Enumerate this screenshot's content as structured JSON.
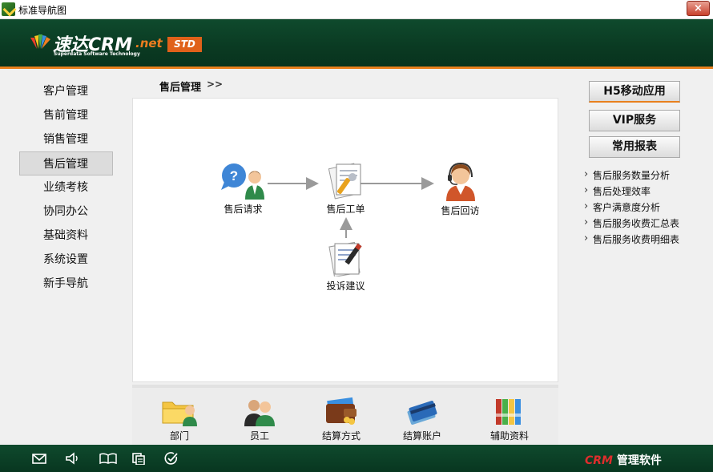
{
  "window": {
    "title": "标准导航图",
    "close_label": "×"
  },
  "header": {
    "logo_main": "速达CRM",
    "logo_net": ".net",
    "logo_sub": "Superdata Software Technology",
    "edition": "STD"
  },
  "left_menu": [
    {
      "label": "客户管理",
      "active": false
    },
    {
      "label": "售前管理",
      "active": false
    },
    {
      "label": "销售管理",
      "active": false
    },
    {
      "label": "售后管理",
      "active": true
    },
    {
      "label": "业绩考核",
      "active": false
    },
    {
      "label": "协同办公",
      "active": false
    },
    {
      "label": "基础资料",
      "active": false
    },
    {
      "label": "系统设置",
      "active": false
    },
    {
      "label": "新手导航",
      "active": false
    }
  ],
  "breadcrumb": {
    "current": "售后管理",
    "arrow": ">>"
  },
  "flow": {
    "request": {
      "label": "售后请求",
      "icon": "question-person-icon"
    },
    "work_order": {
      "label": "售后工单",
      "icon": "document-wrench-icon"
    },
    "revisit": {
      "label": "售后回访",
      "icon": "headset-agent-icon"
    },
    "complaint": {
      "label": "投诉建议",
      "icon": "document-pen-icon"
    }
  },
  "tools": [
    {
      "label": "部门",
      "icon": "folder-person-icon"
    },
    {
      "label": "员工",
      "icon": "people-icon"
    },
    {
      "label": "结算方式",
      "icon": "wallet-icon"
    },
    {
      "label": "结算账户",
      "icon": "bank-card-icon"
    },
    {
      "label": "辅助资料",
      "icon": "binders-icon"
    }
  ],
  "right_panel": {
    "h5_button": "H5移动应用",
    "vip_button": "VIP服务",
    "report_button": "常用报表",
    "reports": [
      "售后服务数量分析",
      "售后处理效率",
      "客户满意度分析",
      "售后服务收费汇总表",
      "售后服务收费明细表"
    ]
  },
  "status_bar": {
    "icons": [
      "mail-icon",
      "speaker-icon",
      "book-icon",
      "copy-icon",
      "check-circle-icon"
    ],
    "brand_crm": "CRM",
    "brand_text": " 管理软件"
  },
  "colors": {
    "header_green": "#0a3a22",
    "accent_orange": "#e8801e",
    "brand_red": "#e02d2d"
  }
}
